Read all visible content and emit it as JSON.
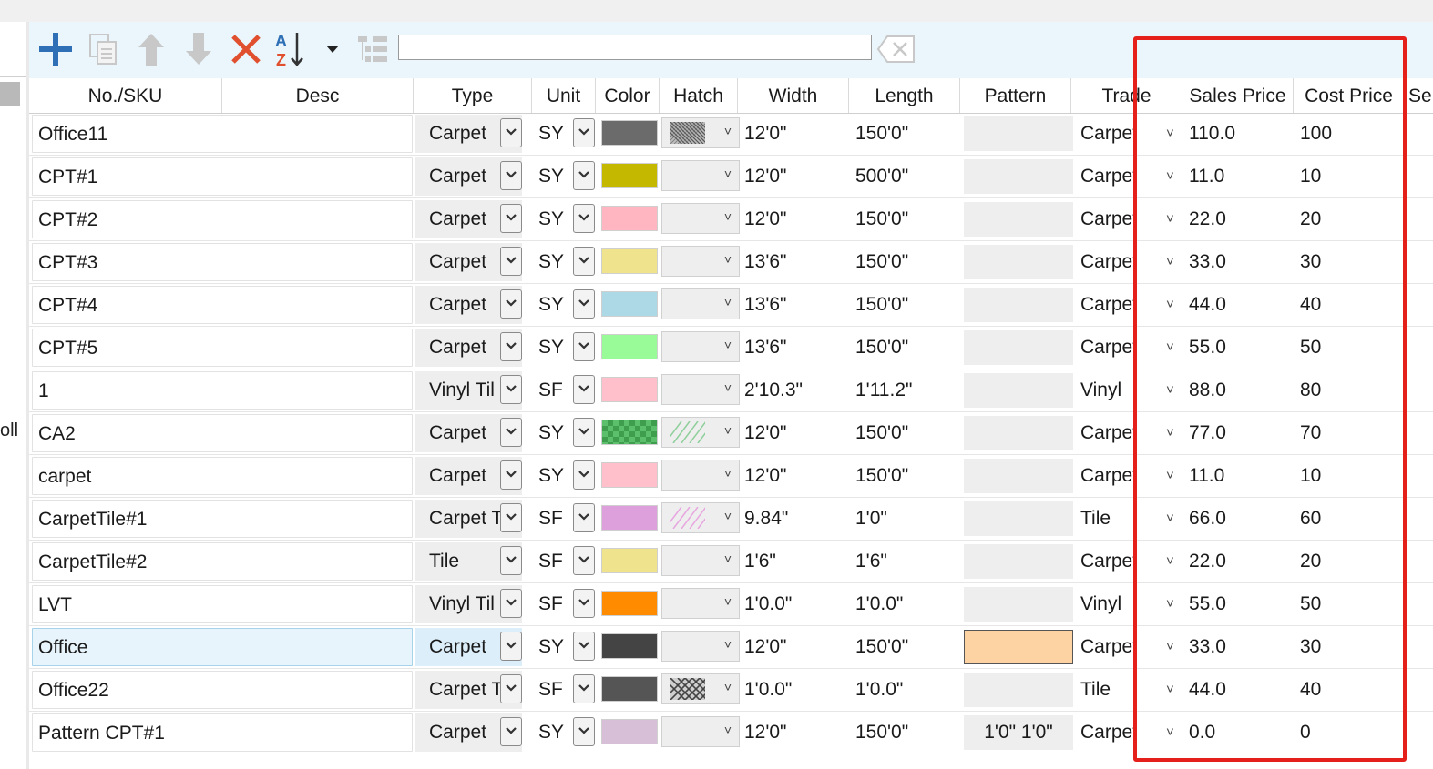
{
  "left_panel": {
    "fragment": "oll"
  },
  "toolbar": {
    "add_icon": "plus-icon",
    "copy_icon": "copy-icon",
    "up_icon": "arrow-up-icon",
    "down_icon": "arrow-down-icon",
    "delete_icon": "delete-x-icon",
    "sort_icon": "sort-az-icon",
    "tree_icon": "tree-view-icon",
    "search": {
      "value": "",
      "placeholder": ""
    },
    "clear_icon": "clear-search-icon",
    "colors": {
      "add": "#2f6fb5",
      "delete": "#e0502e",
      "disabled": "#c8c8c8"
    }
  },
  "columns": [
    "No./SKU",
    "Desc",
    "Type",
    "Unit",
    "Color",
    "Hatch",
    "Width",
    "Length",
    "Pattern",
    "Trade",
    "Sales Price",
    "Cost Price",
    "Se"
  ],
  "rows": [
    {
      "sku": "Office11",
      "type": "Carpet",
      "unit": "SY",
      "color": "#6b6b6b",
      "hatch": "dense",
      "width": "12'0\"",
      "length": "150'0\"",
      "pattern": "",
      "trade": "Carpet",
      "sales": "110.0",
      "cost": "100"
    },
    {
      "sku": "CPT#1",
      "type": "Carpet",
      "unit": "SY",
      "color": "#c4b800",
      "hatch": "none",
      "width": "12'0\"",
      "length": "500'0\"",
      "pattern": "",
      "trade": "Carpet",
      "sales": "11.0",
      "cost": "10"
    },
    {
      "sku": "CPT#2",
      "type": "Carpet",
      "unit": "SY",
      "color": "#ffb6c1",
      "hatch": "none",
      "width": "12'0\"",
      "length": "150'0\"",
      "pattern": "",
      "trade": "Carpet",
      "sales": "22.0",
      "cost": "20"
    },
    {
      "sku": "CPT#3",
      "type": "Carpet",
      "unit": "SY",
      "color": "#efe38e",
      "hatch": "none",
      "width": "13'6\"",
      "length": "150'0\"",
      "pattern": "",
      "trade": "Carpet",
      "sales": "33.0",
      "cost": "30"
    },
    {
      "sku": "CPT#4",
      "type": "Carpet",
      "unit": "SY",
      "color": "#add8e6",
      "hatch": "none",
      "width": "13'6\"",
      "length": "150'0\"",
      "pattern": "",
      "trade": "Carpet",
      "sales": "44.0",
      "cost": "40"
    },
    {
      "sku": "CPT#5",
      "type": "Carpet",
      "unit": "SY",
      "color": "#98fb98",
      "hatch": "none",
      "width": "13'6\"",
      "length": "150'0\"",
      "pattern": "",
      "trade": "Carpet",
      "sales": "55.0",
      "cost": "50"
    },
    {
      "sku": "1",
      "type": "Vinyl Til",
      "unit": "SF",
      "color": "#ffc0cb",
      "hatch": "none",
      "width": "2'10.3\"",
      "length": "1'11.2\"",
      "pattern": "",
      "trade": "Vinyl",
      "sales": "88.0",
      "cost": "80"
    },
    {
      "sku": "CA2",
      "type": "Carpet",
      "unit": "SY",
      "color": "checker-green",
      "hatch": "diag-green",
      "width": "12'0\"",
      "length": "150'0\"",
      "pattern": "",
      "trade": "Carpet",
      "sales": "77.0",
      "cost": "70"
    },
    {
      "sku": "carpet",
      "type": "Carpet",
      "unit": "SY",
      "color": "#ffc0cb",
      "hatch": "none",
      "width": "12'0\"",
      "length": "150'0\"",
      "pattern": "",
      "trade": "Carpet",
      "sales": "11.0",
      "cost": "10"
    },
    {
      "sku": "CarpetTile#1",
      "type": "Carpet T",
      "unit": "SF",
      "color": "#dda0dd",
      "hatch": "diag-pink",
      "width": "9.84\"",
      "length": "1'0\"",
      "pattern": "",
      "trade": "Tile",
      "sales": "66.0",
      "cost": "60"
    },
    {
      "sku": "CarpetTile#2",
      "type": "Tile",
      "unit": "SF",
      "color": "#efe38e",
      "hatch": "none",
      "width": "1'6\"",
      "length": "1'6\"",
      "pattern": "",
      "trade": "Carpet",
      "sales": "22.0",
      "cost": "20"
    },
    {
      "sku": "LVT",
      "type": "Vinyl Til",
      "unit": "SF",
      "color": "#ff8c00",
      "hatch": "none",
      "width": "1'0.0\"",
      "length": "1'0.0\"",
      "pattern": "",
      "trade": "Vinyl",
      "sales": "55.0",
      "cost": "50"
    },
    {
      "sku": "Office",
      "type": "Carpet",
      "unit": "SY",
      "color": "#444444",
      "hatch": "none",
      "width": "12'0\"",
      "length": "150'0\"",
      "pattern": "#fdd3a3",
      "trade": "Carpet",
      "sales": "33.0",
      "cost": "30",
      "selected": true
    },
    {
      "sku": "Office22",
      "type": "Carpet T",
      "unit": "SF",
      "color": "#555555",
      "hatch": "cross",
      "width": "1'0.0\"",
      "length": "1'0.0\"",
      "pattern": "",
      "trade": "Tile",
      "sales": "44.0",
      "cost": "40"
    },
    {
      "sku": "Pattern CPT#1",
      "type": "Carpet",
      "unit": "SY",
      "color": "#d8bfd8",
      "hatch": "none",
      "width": "12'0\"",
      "length": "150'0\"",
      "pattern": "1'0\" 1'0\"",
      "trade": "Carpet",
      "sales": "0.0",
      "cost": "0"
    }
  ],
  "highlight": {
    "color": "#e5201b",
    "columns": [
      "Sales Price",
      "Cost Price"
    ]
  }
}
